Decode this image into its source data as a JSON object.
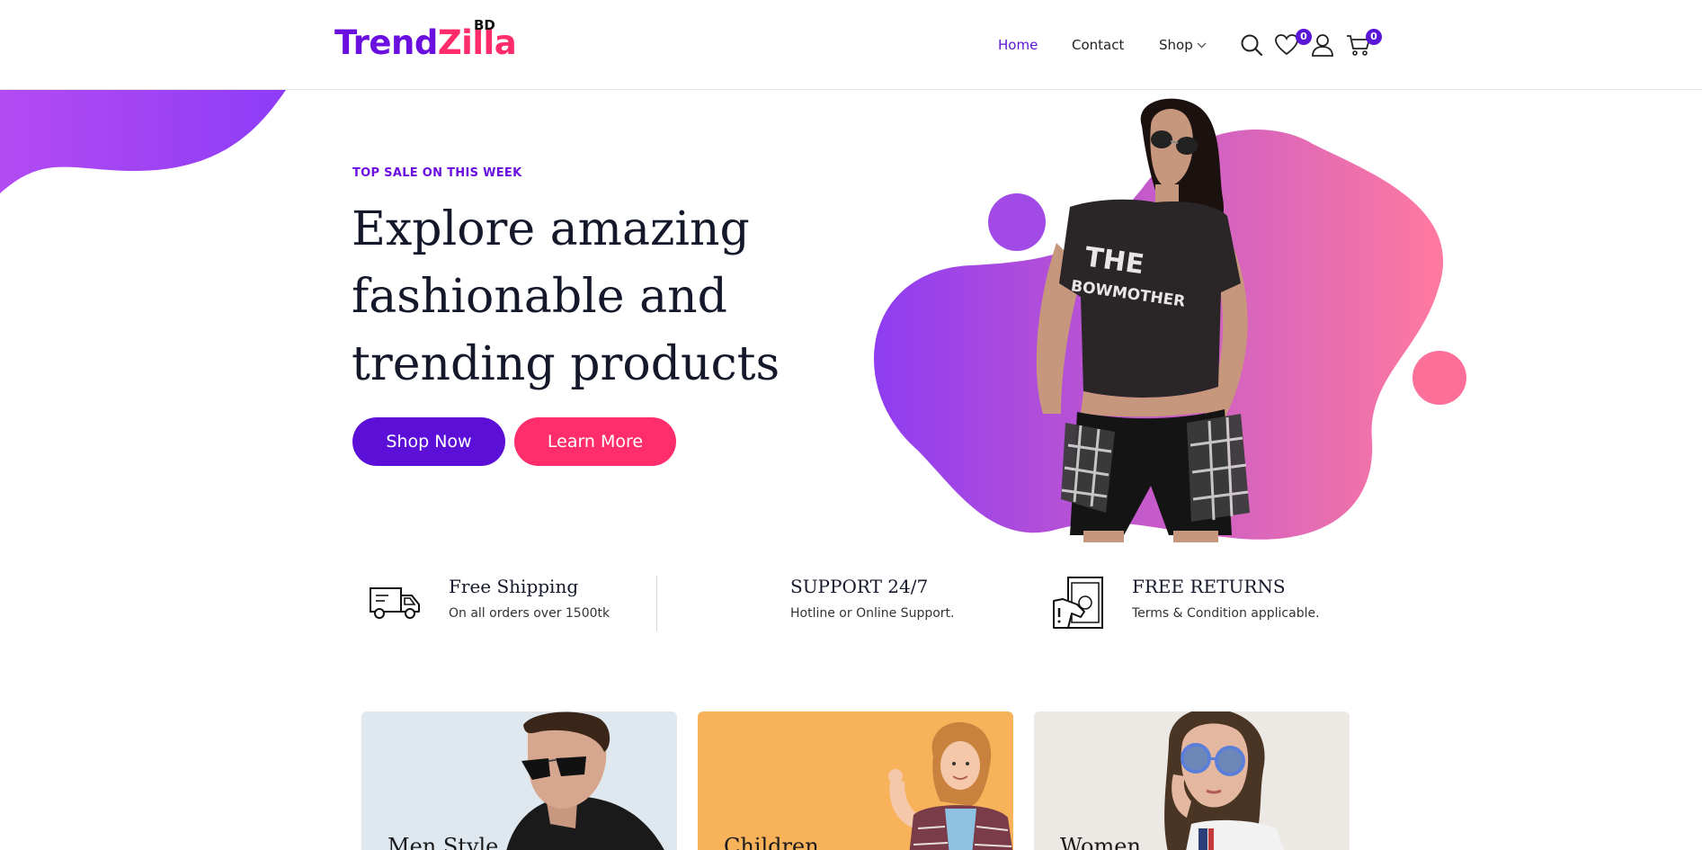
{
  "header": {
    "logo": {
      "part1": "Trend",
      "part2": "Zilla",
      "suffix": "BD"
    },
    "nav": [
      {
        "label": "Home",
        "active": true
      },
      {
        "label": "Contact"
      },
      {
        "label": "Shop",
        "has_dropdown": true
      }
    ],
    "icons": {
      "search": "search-icon",
      "wishlist": "heart-icon",
      "account": "user-icon",
      "cart": "cart-icon"
    },
    "wishlist_count": "0",
    "cart_count": "0"
  },
  "hero": {
    "eyebrow": "TOP SALE ON THIS WEEK",
    "headline_lines": [
      "Explore amazing",
      "fashionable and",
      "trending products"
    ],
    "shop_button": "Shop Now",
    "learn_button": "Learn More",
    "tshirt_print": [
      "THE",
      "BOWMOTHER"
    ]
  },
  "features": [
    {
      "icon": "truck-icon",
      "title": "Free Shipping",
      "subtitle": "On all orders over 1500tk"
    },
    {
      "icon": "",
      "title": "SUPPORT 24/7",
      "subtitle": "Hotline or Online Support."
    },
    {
      "icon": "money-return-icon",
      "title": "FREE RETURNS",
      "subtitle": "Terms & Condition applicable."
    }
  ],
  "categories": [
    {
      "label": "Men Style"
    },
    {
      "label": "Children"
    },
    {
      "label": "Women"
    }
  ],
  "colors": {
    "primary_purple": "#5c0fd6",
    "accent_pink": "#ff2d6b",
    "blob_start": "#8f3cf2",
    "blob_end": "#ff7aa0"
  }
}
